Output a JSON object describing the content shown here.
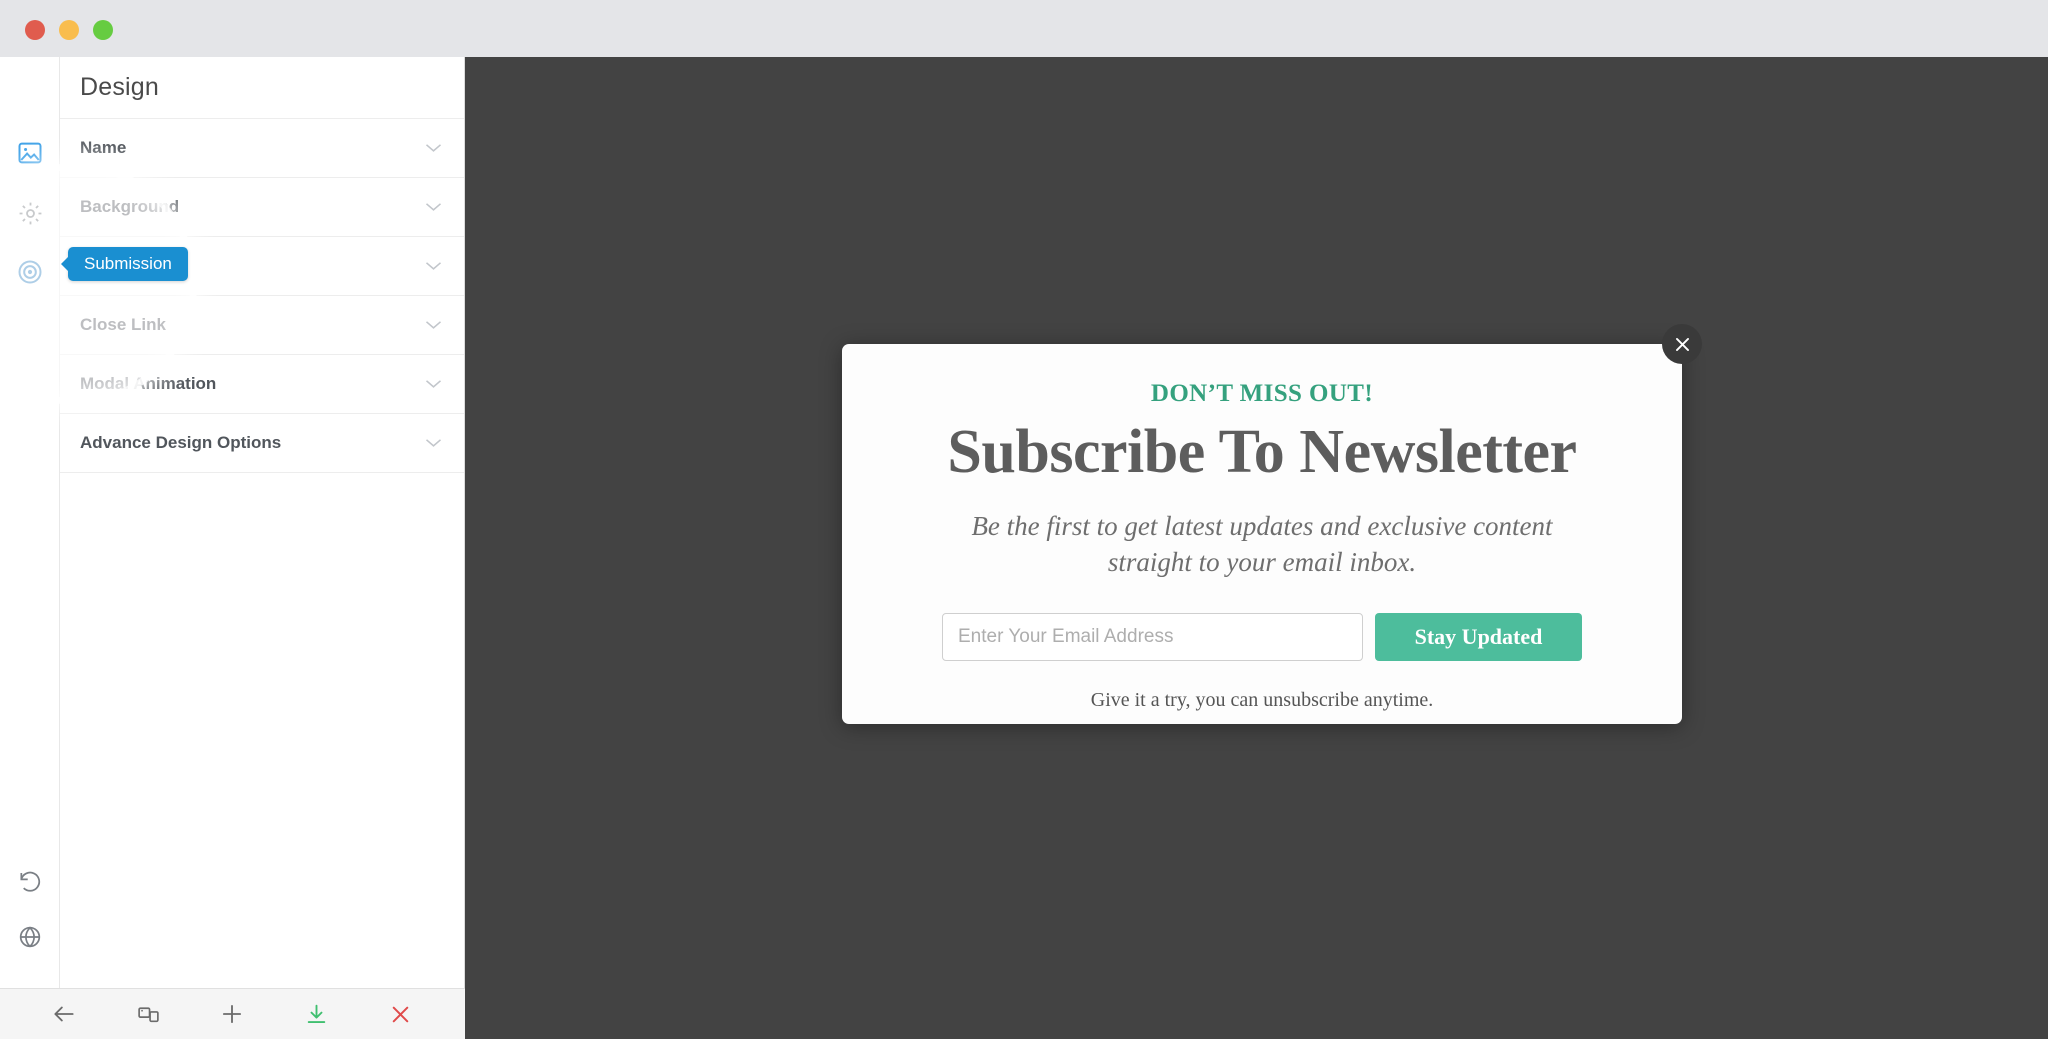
{
  "window": {
    "controls": [
      {
        "name": "close",
        "color": "#e05c4e"
      },
      {
        "name": "minimize",
        "color": "#f9bd4e"
      },
      {
        "name": "maximize",
        "color": "#66cc41"
      }
    ]
  },
  "rail": {
    "items": [
      {
        "icon": "image-icon",
        "state": "active"
      },
      {
        "icon": "gear-icon",
        "state": "default"
      },
      {
        "icon": "target-icon",
        "state": "active"
      }
    ],
    "bottom_items": [
      {
        "icon": "history-undo-icon"
      },
      {
        "icon": "globe-icon"
      }
    ]
  },
  "panel": {
    "title": "Design",
    "rows": [
      {
        "label": "Name"
      },
      {
        "label": "Background"
      },
      {
        "label": ""
      },
      {
        "label": "Close Link"
      },
      {
        "label": "Modal Animation"
      },
      {
        "label": "Advance Design Options"
      }
    ]
  },
  "tooltip": {
    "label": "Submission",
    "color": "#1a8fd1"
  },
  "canvas": {
    "background_color": "#434343"
  },
  "modal": {
    "eyebrow": "DON’T MISS OUT!",
    "headline": "Subscribe To Newsletter",
    "subtitle": "Be the first to get latest updates and exclusive content straight to your email inbox.",
    "email_placeholder": "Enter Your Email Address",
    "email_value": "",
    "submit_label": "Stay Updated",
    "footnote": "Give it a try, you can unsubscribe anytime.",
    "accent_color": "#4dbd9c",
    "eyebrow_color": "#35a17e",
    "close_icon": "close-icon"
  },
  "toolbar": {
    "buttons": [
      {
        "icon": "back-arrow-icon",
        "color": "#6b6b6b"
      },
      {
        "icon": "devices-icon",
        "color": "#6b6b6b"
      },
      {
        "icon": "plus-icon",
        "color": "#6b6b6b"
      },
      {
        "icon": "download-icon",
        "color": "#3fbf6f"
      },
      {
        "icon": "close-x-icon",
        "color": "#e04b4b"
      }
    ]
  }
}
